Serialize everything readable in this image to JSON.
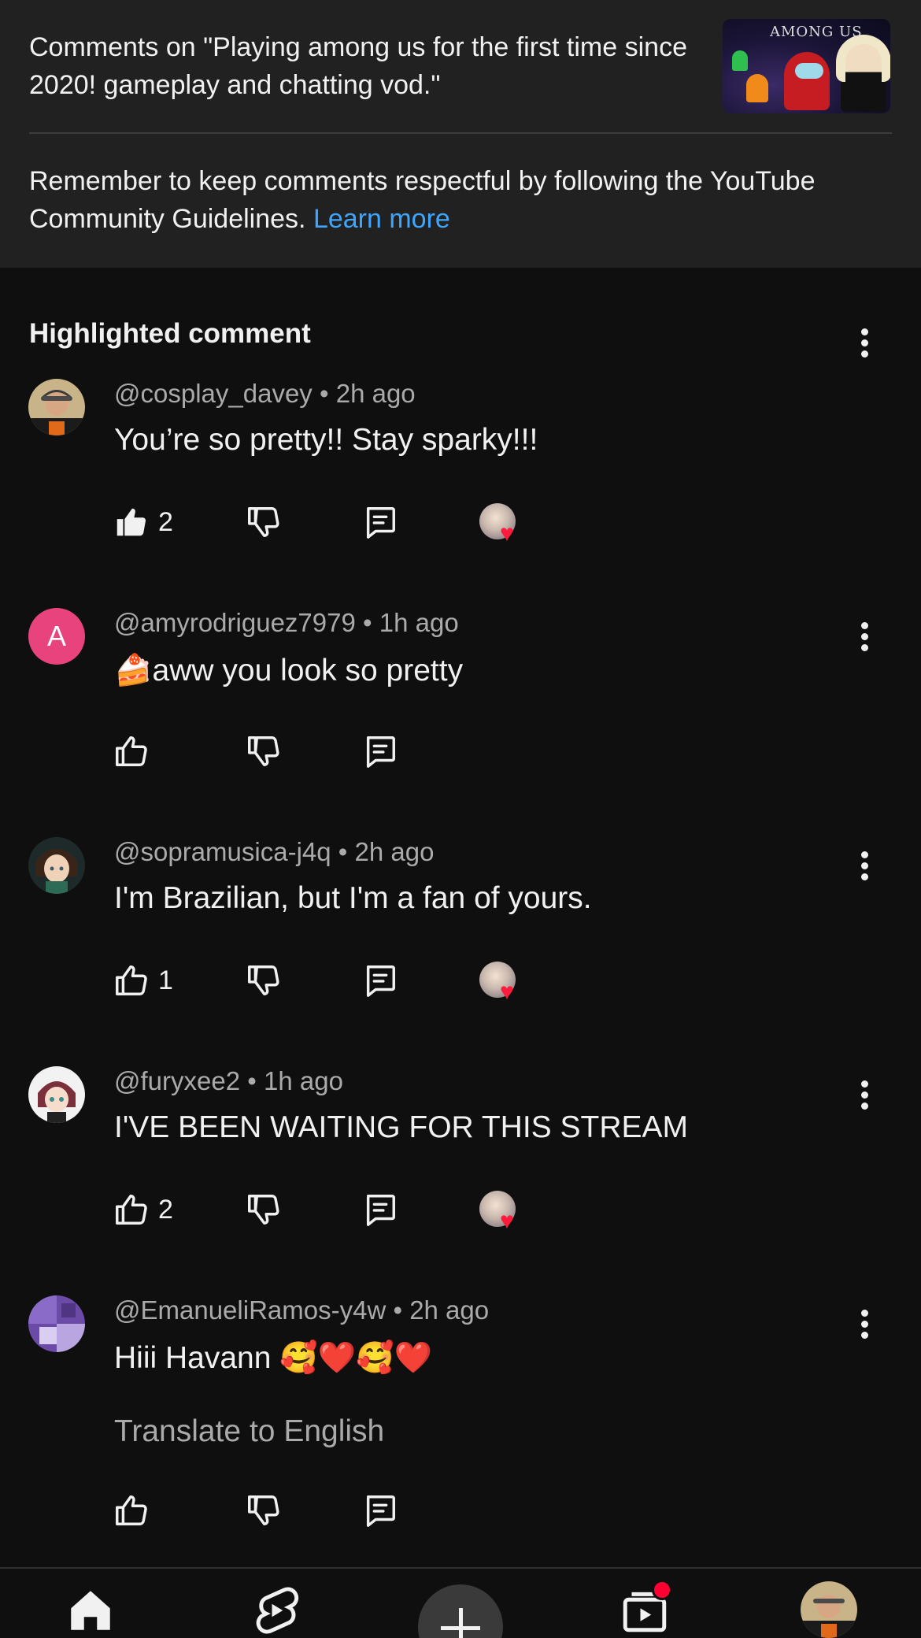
{
  "header": {
    "title": "Comments on \"Playing among us for the first time since 2020! gameplay and chatting vod.\"",
    "thumbnail_text": "AMONG US",
    "guidelines_text": "Remember to keep comments respectful by following the YouTube Community Guidelines.",
    "learn_more": "Learn more"
  },
  "section_title": "Highlighted comment",
  "comments": [
    {
      "author": "@cosplay_davey",
      "time": "2h ago",
      "separator": "•",
      "text": "You’re so pretty!! Stay sparky!!!",
      "likes": "2",
      "liked": true,
      "hearted": true,
      "avatar": "photo-man-cap"
    },
    {
      "author": "@amyrodriguez7979",
      "time": "1h ago",
      "separator": "•",
      "text": "🍰aww you look so pretty",
      "likes": "",
      "liked": false,
      "hearted": false,
      "avatar_letter": "A",
      "avatar_color": "#e8437c"
    },
    {
      "author": "@sopramusica-j4q",
      "time": "2h ago",
      "separator": "•",
      "text": "I'm Brazilian, but I'm a fan of yours.",
      "likes": "1",
      "liked": false,
      "hearted": true,
      "avatar": "anime-character"
    },
    {
      "author": "@furyxee2",
      "time": "1h ago",
      "separator": "•",
      "text": "I'VE BEEN WAITING FOR THIS STREAM",
      "likes": "2",
      "liked": false,
      "hearted": true,
      "avatar": "anime-girl"
    },
    {
      "author": "@EmanueliRamos-y4w",
      "time": "2h ago",
      "separator": "•",
      "text": "Hiii Havann 🥰❤️🥰❤️",
      "likes": "",
      "liked": false,
      "hearted": false,
      "avatar": "purple-collage",
      "translate": "Translate to English"
    }
  ],
  "icons": {
    "more": "more-vertical-icon",
    "like": "thumbs-up-icon",
    "dislike": "thumbs-down-icon",
    "reply": "reply-comment-icon",
    "heart": "creator-heart-icon"
  },
  "bottom_nav": [
    "home-icon",
    "shorts-icon",
    "create-icon",
    "subscriptions-icon",
    "profile-avatar"
  ],
  "colors": {
    "accent_link": "#3ea6ff",
    "heart": "#ff1b3b",
    "background": "#0f0f0f",
    "header_bg": "#212121",
    "notification": "#ff0033"
  }
}
